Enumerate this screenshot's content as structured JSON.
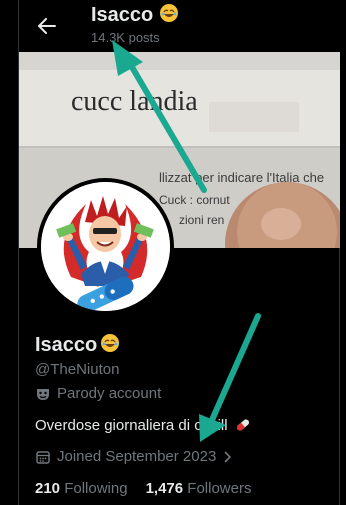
{
  "header": {
    "name": "Isacco",
    "posts": "14.3K posts"
  },
  "banner": {
    "title": "cucc  landia",
    "line1": "llizzat  per indicare l'Italia che",
    "line2": "Cuck : cornut",
    "line3": "zioni ren"
  },
  "profile": {
    "name": "Isacco",
    "handle": "@TheNiuton",
    "parody_label": "Parody account",
    "bio": "Overdose giornaliera di  ckpill",
    "joined": "Joined September 2023",
    "following_count": "210",
    "following_label": "Following",
    "followers_count": "1,476",
    "followers_label": "Followers"
  },
  "colors": {
    "background": "#000000",
    "text": "#e7e9ea",
    "muted": "#71767b",
    "annotation_arrow": "#1aa891"
  }
}
